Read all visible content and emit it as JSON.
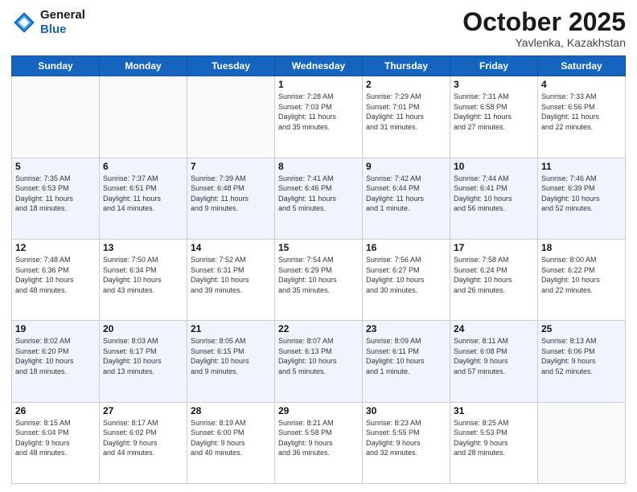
{
  "header": {
    "logo_line1": "General",
    "logo_line2": "Blue",
    "month": "October 2025",
    "location": "Yavlenka, Kazakhstan"
  },
  "days_of_week": [
    "Sunday",
    "Monday",
    "Tuesday",
    "Wednesday",
    "Thursday",
    "Friday",
    "Saturday"
  ],
  "weeks": [
    [
      {
        "day": "",
        "detail": ""
      },
      {
        "day": "",
        "detail": ""
      },
      {
        "day": "",
        "detail": ""
      },
      {
        "day": "1",
        "detail": "Sunrise: 7:28 AM\nSunset: 7:03 PM\nDaylight: 11 hours\nand 35 minutes."
      },
      {
        "day": "2",
        "detail": "Sunrise: 7:29 AM\nSunset: 7:01 PM\nDaylight: 11 hours\nand 31 minutes."
      },
      {
        "day": "3",
        "detail": "Sunrise: 7:31 AM\nSunset: 6:58 PM\nDaylight: 11 hours\nand 27 minutes."
      },
      {
        "day": "4",
        "detail": "Sunrise: 7:33 AM\nSunset: 6:56 PM\nDaylight: 11 hours\nand 22 minutes."
      }
    ],
    [
      {
        "day": "5",
        "detail": "Sunrise: 7:35 AM\nSunset: 6:53 PM\nDaylight: 11 hours\nand 18 minutes."
      },
      {
        "day": "6",
        "detail": "Sunrise: 7:37 AM\nSunset: 6:51 PM\nDaylight: 11 hours\nand 14 minutes."
      },
      {
        "day": "7",
        "detail": "Sunrise: 7:39 AM\nSunset: 6:48 PM\nDaylight: 11 hours\nand 9 minutes."
      },
      {
        "day": "8",
        "detail": "Sunrise: 7:41 AM\nSunset: 6:46 PM\nDaylight: 11 hours\nand 5 minutes."
      },
      {
        "day": "9",
        "detail": "Sunrise: 7:42 AM\nSunset: 6:44 PM\nDaylight: 11 hours\nand 1 minute."
      },
      {
        "day": "10",
        "detail": "Sunrise: 7:44 AM\nSunset: 6:41 PM\nDaylight: 10 hours\nand 56 minutes."
      },
      {
        "day": "11",
        "detail": "Sunrise: 7:46 AM\nSunset: 6:39 PM\nDaylight: 10 hours\nand 52 minutes."
      }
    ],
    [
      {
        "day": "12",
        "detail": "Sunrise: 7:48 AM\nSunset: 6:36 PM\nDaylight: 10 hours\nand 48 minutes."
      },
      {
        "day": "13",
        "detail": "Sunrise: 7:50 AM\nSunset: 6:34 PM\nDaylight: 10 hours\nand 43 minutes."
      },
      {
        "day": "14",
        "detail": "Sunrise: 7:52 AM\nSunset: 6:31 PM\nDaylight: 10 hours\nand 39 minutes."
      },
      {
        "day": "15",
        "detail": "Sunrise: 7:54 AM\nSunset: 6:29 PM\nDaylight: 10 hours\nand 35 minutes."
      },
      {
        "day": "16",
        "detail": "Sunrise: 7:56 AM\nSunset: 6:27 PM\nDaylight: 10 hours\nand 30 minutes."
      },
      {
        "day": "17",
        "detail": "Sunrise: 7:58 AM\nSunset: 6:24 PM\nDaylight: 10 hours\nand 26 minutes."
      },
      {
        "day": "18",
        "detail": "Sunrise: 8:00 AM\nSunset: 6:22 PM\nDaylight: 10 hours\nand 22 minutes."
      }
    ],
    [
      {
        "day": "19",
        "detail": "Sunrise: 8:02 AM\nSunset: 6:20 PM\nDaylight: 10 hours\nand 18 minutes."
      },
      {
        "day": "20",
        "detail": "Sunrise: 8:03 AM\nSunset: 6:17 PM\nDaylight: 10 hours\nand 13 minutes."
      },
      {
        "day": "21",
        "detail": "Sunrise: 8:05 AM\nSunset: 6:15 PM\nDaylight: 10 hours\nand 9 minutes."
      },
      {
        "day": "22",
        "detail": "Sunrise: 8:07 AM\nSunset: 6:13 PM\nDaylight: 10 hours\nand 5 minutes."
      },
      {
        "day": "23",
        "detail": "Sunrise: 8:09 AM\nSunset: 6:11 PM\nDaylight: 10 hours\nand 1 minute."
      },
      {
        "day": "24",
        "detail": "Sunrise: 8:11 AM\nSunset: 6:08 PM\nDaylight: 9 hours\nand 57 minutes."
      },
      {
        "day": "25",
        "detail": "Sunrise: 8:13 AM\nSunset: 6:06 PM\nDaylight: 9 hours\nand 52 minutes."
      }
    ],
    [
      {
        "day": "26",
        "detail": "Sunrise: 8:15 AM\nSunset: 6:04 PM\nDaylight: 9 hours\nand 48 minutes."
      },
      {
        "day": "27",
        "detail": "Sunrise: 8:17 AM\nSunset: 6:02 PM\nDaylight: 9 hours\nand 44 minutes."
      },
      {
        "day": "28",
        "detail": "Sunrise: 8:19 AM\nSunset: 6:00 PM\nDaylight: 9 hours\nand 40 minutes."
      },
      {
        "day": "29",
        "detail": "Sunrise: 8:21 AM\nSunset: 5:58 PM\nDaylight: 9 hours\nand 36 minutes."
      },
      {
        "day": "30",
        "detail": "Sunrise: 8:23 AM\nSunset: 5:55 PM\nDaylight: 9 hours\nand 32 minutes."
      },
      {
        "day": "31",
        "detail": "Sunrise: 8:25 AM\nSunset: 5:53 PM\nDaylight: 9 hours\nand 28 minutes."
      },
      {
        "day": "",
        "detail": ""
      }
    ]
  ]
}
